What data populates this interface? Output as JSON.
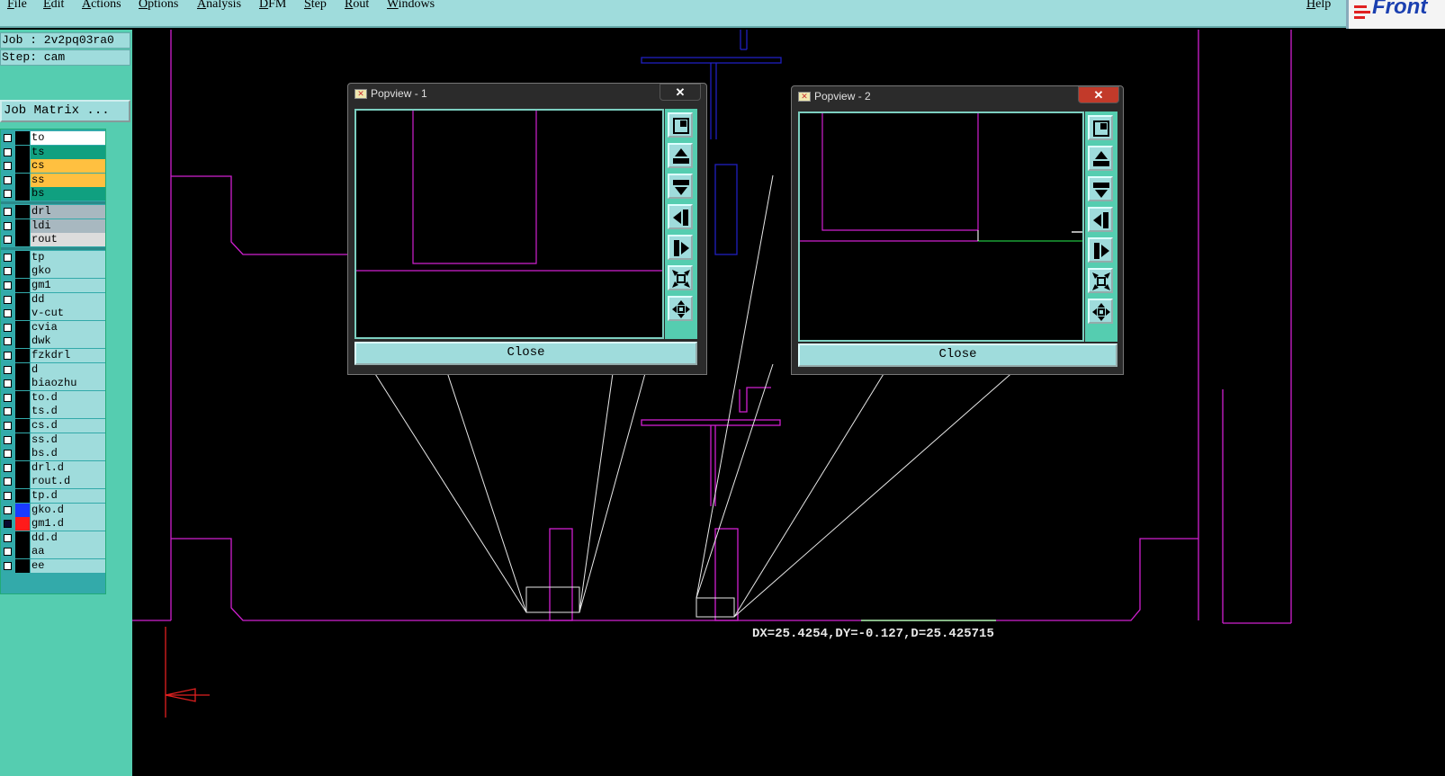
{
  "menubar": {
    "items": [
      "File",
      "Edit",
      "Actions",
      "Options",
      "Analysis",
      "DFM",
      "Step",
      "Rout",
      "Windows"
    ],
    "help": "Help"
  },
  "logo": {
    "text": "Front"
  },
  "job": {
    "label": "Job : 2v2pq03ra0",
    "step": "Step: cam",
    "matrix_button": "Job Matrix ..."
  },
  "layers": [
    {
      "name": "to",
      "color": "#ffffff"
    },
    {
      "name": "ts",
      "color": "#10a080"
    },
    {
      "name": "cs",
      "color": "#ffc040"
    },
    {
      "name": "ss",
      "color": "#ffc040"
    },
    {
      "name": "bs",
      "color": "#10a080"
    },
    {
      "name": "drl",
      "color": "#a8b8c0"
    },
    {
      "name": "ldi",
      "color": "#a8b8c0"
    },
    {
      "name": "rout",
      "color": "#dcdcdc"
    },
    {
      "name": "tp",
      "color": "#9fdcdc"
    },
    {
      "name": "gko",
      "color": "#9fdcdc"
    },
    {
      "name": "gm1",
      "color": "#9fdcdc"
    },
    {
      "name": "dd",
      "color": "#9fdcdc"
    },
    {
      "name": "v-cut",
      "color": "#9fdcdc"
    },
    {
      "name": "cvia",
      "color": "#9fdcdc"
    },
    {
      "name": "dwk",
      "color": "#9fdcdc"
    },
    {
      "name": "fzkdrl",
      "color": "#9fdcdc"
    },
    {
      "name": "d",
      "color": "#9fdcdc"
    },
    {
      "name": "biaozhu",
      "color": "#9fdcdc"
    },
    {
      "name": "to.d",
      "color": "#9fdcdc"
    },
    {
      "name": "ts.d",
      "color": "#9fdcdc"
    },
    {
      "name": "cs.d",
      "color": "#9fdcdc"
    },
    {
      "name": "ss.d",
      "color": "#9fdcdc"
    },
    {
      "name": "bs.d",
      "color": "#9fdcdc"
    },
    {
      "name": "drl.d",
      "color": "#9fdcdc"
    },
    {
      "name": "rout.d",
      "color": "#9fdcdc"
    },
    {
      "name": "tp.d",
      "color": "#9fdcdc"
    },
    {
      "name": "gko.d",
      "color": "#9fdcdc",
      "swatch": "#1a3aff"
    },
    {
      "name": "gm1.d",
      "color": "#9fdcdc",
      "swatch": "#ff1a1a",
      "active": true
    },
    {
      "name": "dd.d",
      "color": "#9fdcdc"
    },
    {
      "name": "aa",
      "color": "#9fdcdc"
    },
    {
      "name": "ee",
      "color": "#9fdcdc"
    }
  ],
  "popview1": {
    "title": "Popview - 1",
    "close_label": "Close",
    "title_close": "✕"
  },
  "popview2": {
    "title": "Popview - 2",
    "close_label": "Close",
    "title_close": "✕"
  },
  "measurement": "DX=25.4254,DY=-0.127,D=25.425715"
}
